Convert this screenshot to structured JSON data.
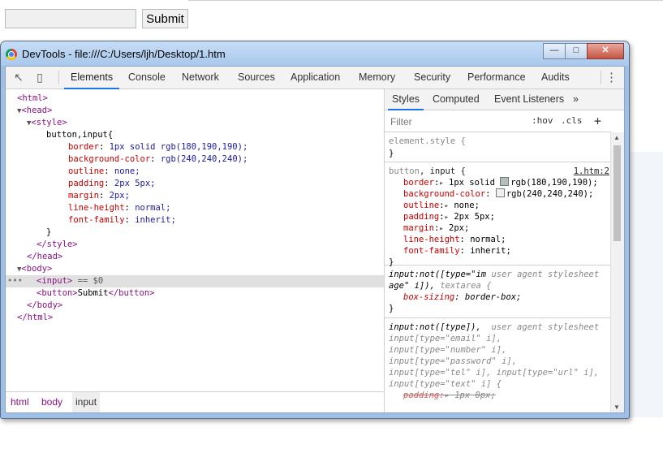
{
  "page": {
    "input_value": "",
    "submit_label": "Submit"
  },
  "window": {
    "title": "DevTools - file:///C:/Users/ljh/Desktop/1.htm",
    "min_glyph": "—",
    "max_glyph": "□",
    "close_glyph": "✕"
  },
  "toolbar": {
    "inspect_icon": "↖",
    "device_icon": "▯",
    "tabs": [
      "Elements",
      "Console",
      "Network",
      "Sources",
      "Application",
      "Memory",
      "Security",
      "Performance",
      "Audits"
    ],
    "more_icon": "⋮"
  },
  "dom": {
    "html_open": "<html>",
    "head_open": "<head>",
    "style_open": "<style>",
    "selector": "button,input{",
    "decls": [
      {
        "prop": "border",
        "val": "1px solid rgb(180,190,190);"
      },
      {
        "prop": "background-color",
        "val": "rgb(240,240,240);"
      },
      {
        "prop": "outline",
        "val": "none;"
      },
      {
        "prop": "padding",
        "val": "2px 5px;"
      },
      {
        "prop": "margin",
        "val": "2px;"
      },
      {
        "prop": "line-height",
        "val": "normal;"
      },
      {
        "prop": "font-family",
        "val": "inherit;"
      }
    ],
    "close_brace": "}",
    "style_close": "</style>",
    "head_close": "</head>",
    "body_open": "<body>",
    "dots": "•••",
    "input_tag": "<input>",
    "input_suffix": " == $0",
    "button_open": "<button>",
    "button_text": "Submit",
    "button_close": "</button>",
    "body_close": "</body>",
    "html_close": "</html>"
  },
  "breadcrumbs": [
    "html",
    "body",
    "input"
  ],
  "styles": {
    "subtabs": [
      "Styles",
      "Computed",
      "Event Listeners",
      "»"
    ],
    "filter_placeholder": "Filter",
    "hov": ":hov",
    "cls": ".cls",
    "plus": "+",
    "element_style": "element.style {",
    "element_close": "}",
    "rule1_selector_a": "button",
    "rule1_selector_b": ", input {",
    "rule1_source": "1.htm:2",
    "rule1_decls": [
      {
        "prop": "border",
        "arrow": "▸",
        "swatch": "#b4bebe",
        "val": "1px solid ",
        "val2": "rgb(180,190,190);"
      },
      {
        "prop": "background-color",
        "arrow": "",
        "swatch": "#f0f0f0",
        "val": "",
        "val2": "rgb(240,240,240);"
      },
      {
        "prop": "outline",
        "arrow": "▸",
        "swatch": "",
        "val": "",
        "val2": "none;"
      },
      {
        "prop": "padding",
        "arrow": "▸",
        "swatch": "",
        "val": "",
        "val2": "2px 5px;"
      },
      {
        "prop": "margin",
        "arrow": "▸",
        "swatch": "",
        "val": "",
        "val2": "2px;"
      },
      {
        "prop": "line-height",
        "arrow": "",
        "swatch": "",
        "val": "",
        "val2": "normal;"
      },
      {
        "prop": "font-family",
        "arrow": "",
        "swatch": "",
        "val": "",
        "val2": "inherit;"
      }
    ],
    "rule1_close": "}",
    "rule2_line1_a": "input:not([type=\"im",
    "rule2_ua": "user agent stylesheet",
    "rule2_line2_a": "age\" i]), ",
    "rule2_line2_b": "textarea {",
    "rule2_decl_prop": "box-sizing",
    "rule2_decl_val": "border-box;",
    "rule2_close": "}",
    "rule3_line1": "input:not([type]),",
    "rule3_ua": "user agent stylesheet",
    "rule3_lines": [
      "input[type=\"email\" i],",
      "input[type=\"number\" i],",
      "input[type=\"password\" i],",
      "input[type=\"tel\" i], input[type=\"url\" i],",
      "input[type=\"text\" i] {"
    ],
    "rule3_strike_prop": "padding:",
    "rule3_strike_val": "1px 0px;"
  },
  "colors": {
    "tag": "#881280",
    "prop": "#c80000",
    "value": "#1a1aa6",
    "accent": "#1a73e8"
  }
}
